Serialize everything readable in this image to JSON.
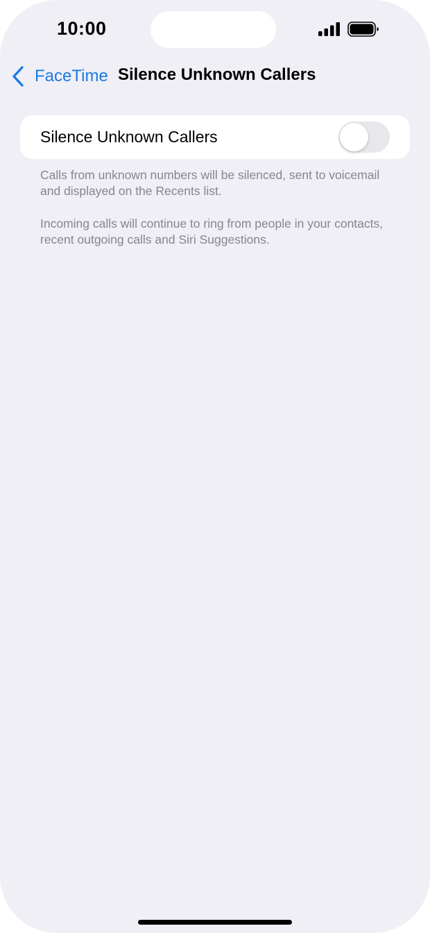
{
  "status_bar": {
    "time": "10:00",
    "signal_icon": "cellular-signal-icon",
    "battery_icon": "battery-icon"
  },
  "nav": {
    "back_label": "FaceTime",
    "title": "Silence Unknown Callers",
    "accent_color": "#1a7ae6"
  },
  "setting": {
    "label": "Silence Unknown Callers",
    "enabled": false
  },
  "footnotes": [
    "Calls from unknown numbers will be silenced, sent to voicemail and displayed on the Recents list.",
    "Incoming calls will continue to ring from people in your contacts, recent outgoing calls and Siri Suggestions."
  ]
}
